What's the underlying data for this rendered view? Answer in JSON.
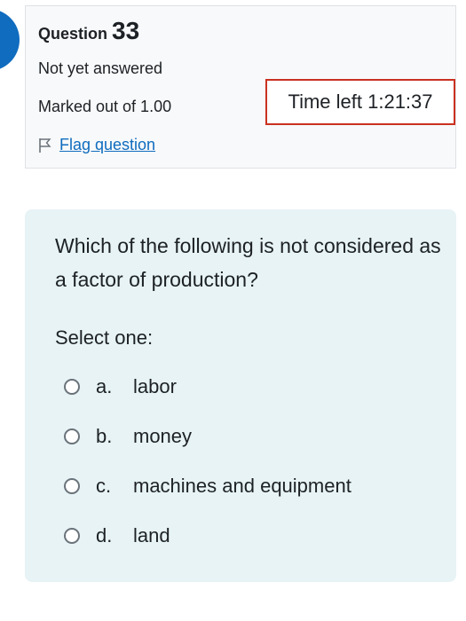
{
  "info": {
    "question_word": "Question",
    "question_number": "33",
    "state": "Not yet answered",
    "grade": "Marked out of 1.00",
    "timer": "Time left 1:21:37",
    "flag_label": "Flag question"
  },
  "question": {
    "text": "Which of the following is not considered as a factor of production?",
    "prompt": "Select one:",
    "options": [
      {
        "letter": "a.",
        "label": "labor"
      },
      {
        "letter": "b.",
        "label": "money"
      },
      {
        "letter": "c.",
        "label": "machines and equipment"
      },
      {
        "letter": "d.",
        "label": "land"
      }
    ]
  },
  "colors": {
    "accent": "#0f6cbf",
    "timer_border": "#ca3120",
    "formulation_bg": "#e7f3f5"
  }
}
